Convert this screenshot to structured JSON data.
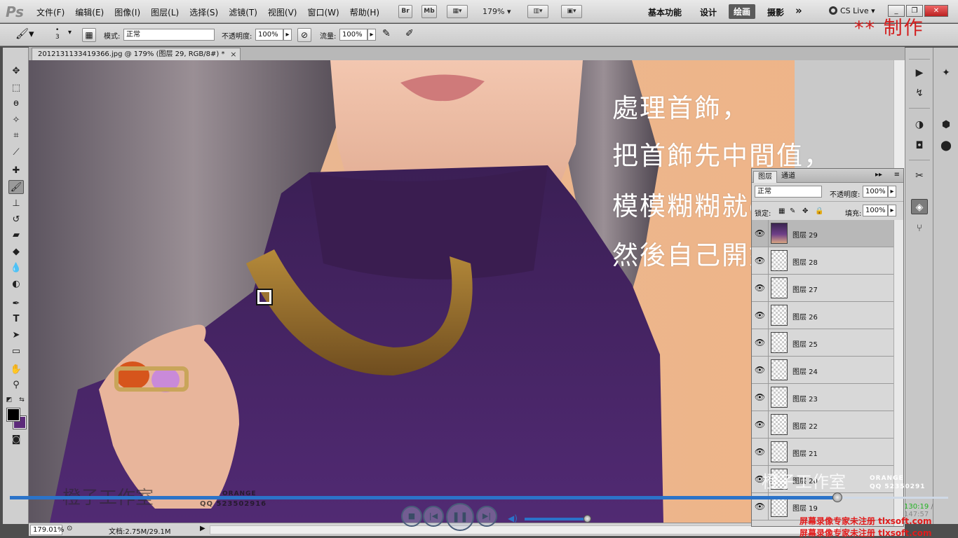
{
  "app": {
    "logo": "Ps"
  },
  "menus": [
    "文件(F)",
    "编辑(E)",
    "图像(I)",
    "图层(L)",
    "选择(S)",
    "滤镜(T)",
    "视图(V)",
    "窗口(W)",
    "帮助(H)"
  ],
  "appbar": {
    "br": "Br",
    "mb": "Mb",
    "zoom": "179%"
  },
  "workspaces": {
    "basic": "基本功能",
    "design": "设计",
    "painting": "绘画",
    "photo": "摄影",
    "more": "»"
  },
  "cslive": "CS Live ▾",
  "options": {
    "brush_size": "3",
    "mode_label": "模式:",
    "mode_value": "正常",
    "opacity_label": "不透明度:",
    "opacity_value": "100%",
    "flow_label": "流量:",
    "flow_value": "100%"
  },
  "stamp": "** 制作",
  "document": {
    "tab_title": "2012131133419366.jpg @ 179% (图层 29, RGB/8#) *",
    "close": "×"
  },
  "status": {
    "zoom": "179.01%",
    "doc": "文档:2.75M/29.1M",
    "arrow": "▶"
  },
  "overlay_text": [
    "處理首飾，",
    "把首飾先中間值，",
    "模模糊糊就ok。",
    "然後自己開始畫。"
  ],
  "brand": {
    "name": "橙子工作室",
    "en": "ORANGE",
    "qq": "QQ 523502916",
    "en2": "ORANGE",
    "qq2": "QQ 52350291"
  },
  "layers_panel": {
    "tabs": [
      "图层",
      "通道"
    ],
    "blend_mode": "正常",
    "opacity_label": "不透明度:",
    "opacity_value": "100%",
    "lock_label": "锁定:",
    "fill_label": "填充:",
    "fill_value": "100%",
    "layers": [
      "图层 29",
      "图层 28",
      "图层 27",
      "图层 26",
      "图层 25",
      "图层 24",
      "图层 23",
      "图层 22",
      "图层 21",
      "图层 20",
      "图层 19"
    ]
  },
  "player": {
    "current": "130:19",
    "sep": " / ",
    "total": "147:57",
    "progress": 0.882,
    "volume": 0.97
  },
  "watermark": {
    "line1": "屏幕录像专家未注册  tlxsoft.com",
    "line2": "屏幕录像专家未注册  tlxsoft.com"
  }
}
